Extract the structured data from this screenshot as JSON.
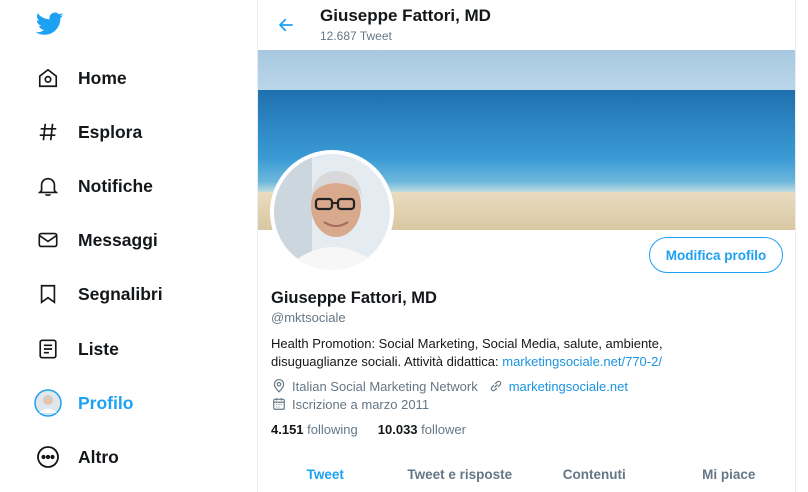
{
  "sidebar": {
    "items": [
      {
        "label": "Home",
        "icon": "home-icon"
      },
      {
        "label": "Esplora",
        "icon": "hashtag-icon"
      },
      {
        "label": "Notifiche",
        "icon": "bell-icon"
      },
      {
        "label": "Messaggi",
        "icon": "envelope-icon"
      },
      {
        "label": "Segnalibri",
        "icon": "bookmark-icon"
      },
      {
        "label": "Liste",
        "icon": "list-icon"
      },
      {
        "label": "Profilo",
        "icon": "avatar-icon",
        "active": true
      },
      {
        "label": "Altro",
        "icon": "more-icon"
      }
    ]
  },
  "header": {
    "title": "Giuseppe Fattori, MD",
    "subtitle": "12.687 Tweet"
  },
  "profile": {
    "edit_label": "Modifica profilo",
    "name": "Giuseppe Fattori, MD",
    "handle": "@mktsociale",
    "bio_text": "Health Promotion: Social Marketing, Social Media, salute, ambiente, disuguaglianze sociali.  Attività didattica: ",
    "bio_link": "marketingsociale.net/770-2/",
    "location": "Italian Social Marketing Network",
    "website": "marketingsociale.net",
    "joined": "Iscrizione a marzo 2011",
    "following_count": "4.151",
    "following_label": "following",
    "followers_count": "10.033",
    "followers_label": "follower"
  },
  "tabs": [
    {
      "label": "Tweet",
      "active": true
    },
    {
      "label": "Tweet e risposte"
    },
    {
      "label": "Contenuti"
    },
    {
      "label": "Mi piace"
    }
  ],
  "colors": {
    "accent": "#1da1f2",
    "text": "#14171a",
    "secondary": "#657786",
    "link": "#1b95e0"
  }
}
